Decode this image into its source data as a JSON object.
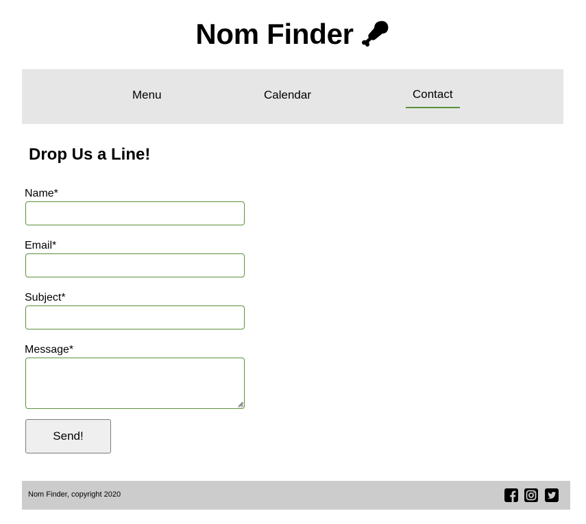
{
  "header": {
    "title": "Nom Finder",
    "logo_icon": "chicken-leg-icon"
  },
  "nav": {
    "items": [
      {
        "label": "Menu"
      },
      {
        "label": "Calendar"
      },
      {
        "label": "Contact",
        "active": true
      }
    ],
    "active_color": "#5a8f3a",
    "background": "#e6e6e6"
  },
  "form": {
    "title": "Drop Us a Line!",
    "fields": {
      "name": {
        "label": "Name*",
        "value": ""
      },
      "email": {
        "label": "Email*",
        "value": ""
      },
      "subject": {
        "label": "Subject*",
        "value": ""
      },
      "message": {
        "label": "Message*",
        "value": ""
      }
    },
    "submit_label": "Send!",
    "border_color": "#5a8f3a"
  },
  "footer": {
    "copyright": "Nom Finder, copyright 2020",
    "social_icons": [
      "facebook-icon",
      "instagram-icon",
      "twitter-icon"
    ],
    "background": "#cccccc"
  }
}
